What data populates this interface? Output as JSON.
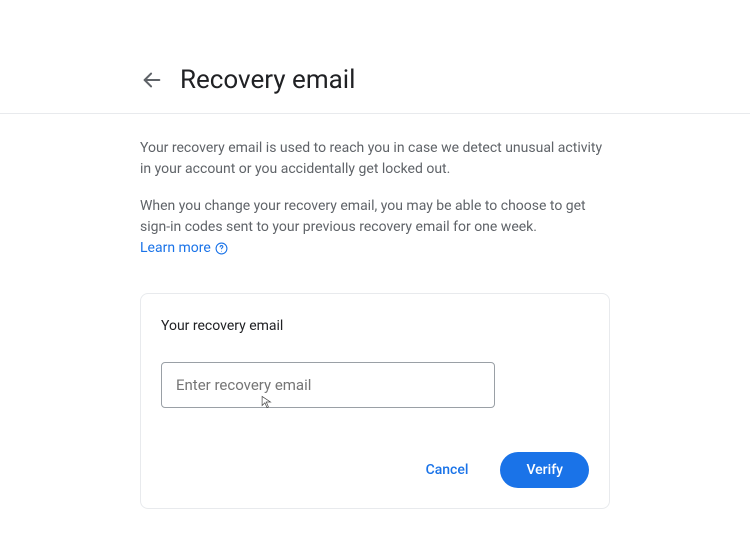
{
  "header": {
    "title": "Recovery email"
  },
  "body": {
    "paragraph1": "Your recovery email is used to reach you in case we detect unusual activity in your account or you accidentally get locked out.",
    "paragraph2": "When you change your recovery email, you may be able to choose to get sign-in codes sent to your previous recovery email for one week.",
    "learn_more": "Learn more"
  },
  "card": {
    "label": "Your recovery email",
    "input_placeholder": "Enter recovery email",
    "input_value": "",
    "cancel_label": "Cancel",
    "verify_label": "Verify"
  }
}
